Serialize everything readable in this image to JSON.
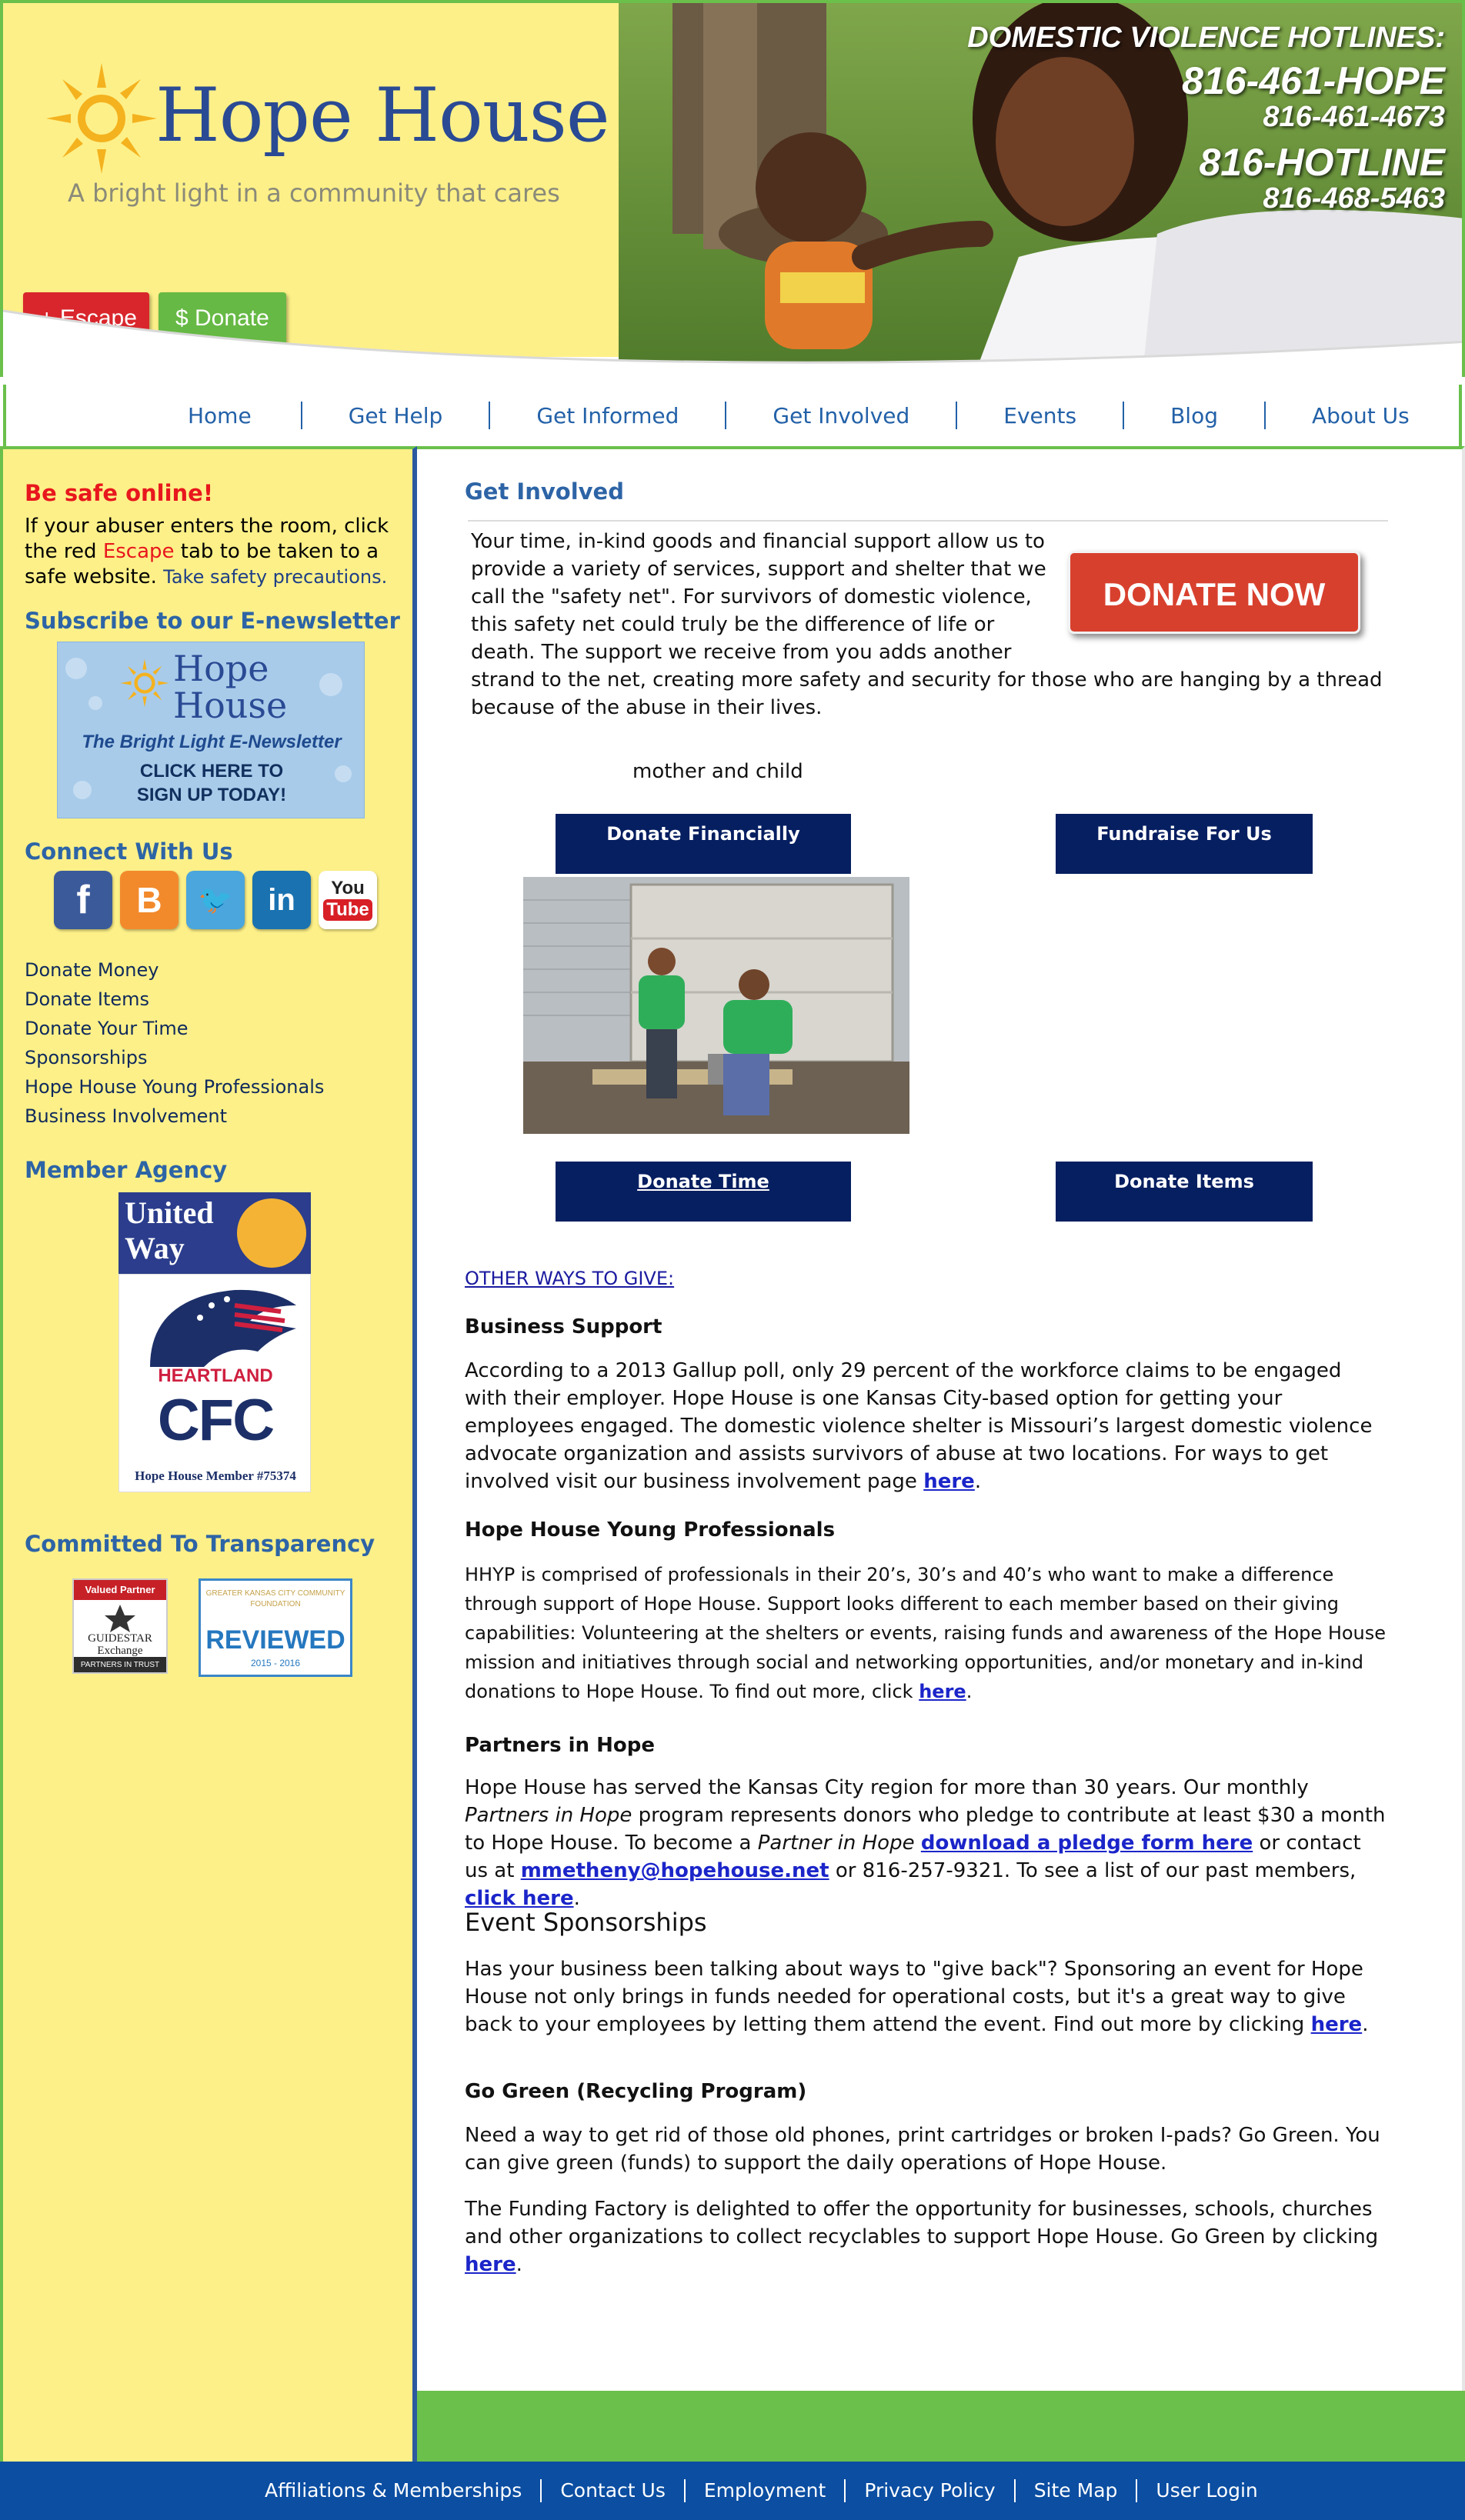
{
  "brand": {
    "name": "Hope House",
    "tagline": "A bright light in a community that cares"
  },
  "header": {
    "escape_label": "+ Escape",
    "donate_label": "$ Donate",
    "hotlines_title": "DOMESTIC VIOLENCE HOTLINES:",
    "hotline_1": "816-461-HOPE",
    "hotline_1_num": "816-461-4673",
    "hotline_2": "816-HOTLINE",
    "hotline_2_num": "816-468-5463"
  },
  "nav": {
    "items": [
      "Home",
      "Get Help",
      "Get Informed",
      "Get Involved",
      "Events",
      "Blog",
      "About Us"
    ]
  },
  "sidebar": {
    "safe_title": "Be safe online!",
    "safe_text_1": "If your abuser enters the room, click the red ",
    "safe_text_red": "Escape",
    "safe_text_2": " tab to be taken to a safe website. ",
    "safe_link": "Take safety precautions.",
    "subscribe_head": "Subscribe to our E-newsletter",
    "newsletter": {
      "title_1": "Hope",
      "title_2": "House",
      "subtitle": "The Bright Light E-Newsletter",
      "cta_1": "CLICK HERE TO",
      "cta_2": "SIGN UP TODAY!"
    },
    "connect_head": "Connect With Us",
    "social": [
      "facebook-icon",
      "blogger-icon",
      "twitter-icon",
      "linkedin-icon",
      "youtube-icon"
    ],
    "links": [
      "Donate Money",
      "Donate Items",
      "Donate Your Time",
      "Sponsorships",
      "Hope House Young Professionals",
      "Business Involvement"
    ],
    "member_head": "Member Agency",
    "united_way": "United Way",
    "cfc": {
      "heartland": "HEARTLAND",
      "letters": "CFC",
      "member": "Hope House Member #75374"
    },
    "transparency_head": "Committed To Transparency",
    "guidestar": {
      "top": "Valued Partner",
      "name": "GUIDESTAR Exchange",
      "bottom": "PARTNERS IN TRUST"
    },
    "gkccf": {
      "top": "GREATER KANSAS CITY COMMUNITY FOUNDATION",
      "reviewed": "REVIEWED",
      "year": "2015 - 2016"
    }
  },
  "main": {
    "title": "Get Involved",
    "donate_now": "DONATE NOW",
    "intro_1": "Your time, in-kind goods and financial support allow us to provide a variety of services, support and shelter that we call the \"safety net\". For survivors of domestic violence, this safety net could truly be the difference of life or death. The support we receive from you adds another",
    "intro_2": "strand to the net, creating more safety and security for those who are hanging by a thread because of the abuse in their lives.",
    "image_caption": "mother and child",
    "tiles": {
      "donate_financially": "Donate Financially",
      "fundraise": "Fundraise For Us",
      "donate_time": "Donate Time",
      "donate_items": "Donate Items"
    },
    "other_ways": "OTHER WAYS TO GIVE:",
    "business": {
      "heading": "Business Support",
      "text": "According to a 2013 Gallup poll, only 29 percent of the workforce claims to be engaged with their employer. Hope House is one Kansas City-based option for getting your employees engaged. The domestic violence shelter is Missouri’s largest domestic violence advocate organization and assists survivors of abuse at two locations. For ways to get involved visit our business involvement page ",
      "link": "here",
      "end": "."
    },
    "hhyp": {
      "heading": "Hope House Young Professionals",
      "text": "HHYP is comprised of professionals in their 20’s, 30’s and 40’s who want to make a difference through support of Hope House. Support looks different to each member based on their giving capabilities: Volunteering at the shelters or events, raising funds and awareness of the Hope House mission and initiatives through social and networking opportunities, and/or monetary and in-kind donations to Hope House. To find out more, click ",
      "link": "here",
      "end": "."
    },
    "partners": {
      "heading": "Partners in Hope",
      "text_1": "Hope House has served the Kansas City region for more than 30 years. Our monthly ",
      "italic_1": "Partners in Hope",
      "text_2": " program represents donors who pledge to contribute at least $30 a month to Hope House. To become a ",
      "italic_2": "Partner in Hope",
      "text_3": " ",
      "link_pledge": "download a pledge form here",
      "text_4": " or contact us at ",
      "link_email": "mmetheny@hopehouse.net",
      "text_5": " or 816-257-9321. To see a list of our past members, ",
      "link_members": "click here",
      "end": "."
    },
    "events": {
      "heading": "Event Sponsorships",
      "text": "Has your business been talking about ways to \"give back\"? Sponsoring an event for Hope House not only brings in funds needed for operational costs, but it's a great way to give back to your employees by letting them attend the event. Find out more by clicking ",
      "link": "here",
      "end": "."
    },
    "green": {
      "heading": "Go Green (Recycling Program)",
      "text_1": "Need a way to get rid of those old phones, print cartridges or broken I-pads? Go Green. You can give green (funds) to support the daily operations of Hope House.",
      "text_2": "The Funding Factory is delighted to offer the opportunity for businesses, schools, churches and other organizations to collect recyclables to support Hope House. Go Green by clicking ",
      "link": "here",
      "end": "."
    }
  },
  "footer": {
    "items": [
      "Affiliations & Memberships",
      "Contact Us",
      "Employment",
      "Privacy Policy",
      "Site Map",
      "User Login"
    ]
  },
  "colors": {
    "yellow": "#fdf088",
    "green": "#6bc04b",
    "navy": "#061f61",
    "footer_blue": "#0b4ea2",
    "heading_blue": "#2d64a6",
    "escape_red": "#d9262c"
  }
}
